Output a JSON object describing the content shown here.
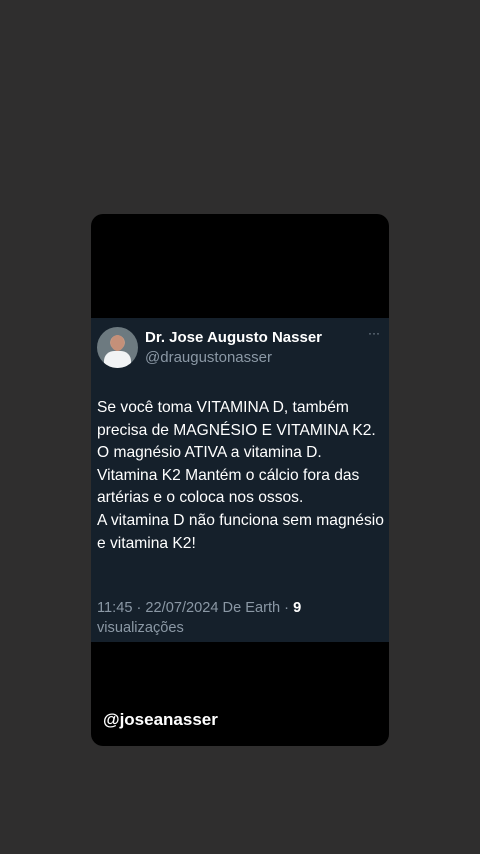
{
  "tweet": {
    "author": {
      "display_name": "Dr. Jose Augusto Nasser",
      "handle": "@draugustonasser"
    },
    "more_icon": "more-horizontal-icon",
    "lines": [
      "Se você toma VITAMINA D, também precisa de MAGNÉSIO E VITAMINA K2.",
      "O magnésio ATIVA a vitamina D.",
      "Vitamina K2 Mantém o cálcio fora das artérias e o coloca nos ossos.",
      "A vitamina D não funciona sem magnésio e vitamina K2!"
    ],
    "meta": {
      "time": "11:45",
      "separator": " · ",
      "date": "22/07/2024",
      "source": "De Earth",
      "views_count": "9",
      "views_label": "visualizações"
    }
  },
  "watermark": "@joseanasser",
  "colors": {
    "page_background": "#2f2e2e",
    "story_background": "#000000",
    "card_background": "#15202b",
    "secondary_text": "#8b98a5",
    "primary_text": "#ffffff"
  }
}
